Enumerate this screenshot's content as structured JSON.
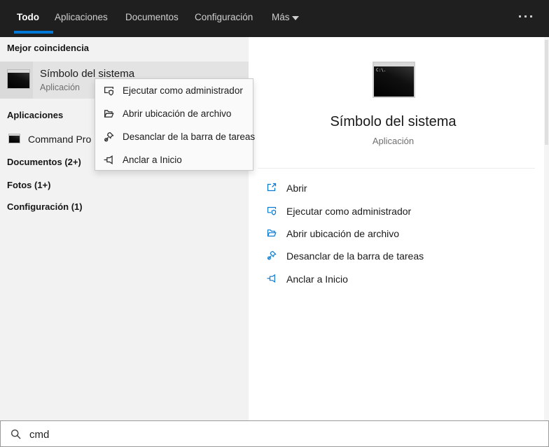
{
  "colors": {
    "accent": "#0078d7",
    "topbar_bg": "#1f1f1f",
    "panel_bg": "#f2f2f2",
    "action_icon": "#0b7ad1"
  },
  "topbar": {
    "tabs": [
      "Todo",
      "Aplicaciones",
      "Documentos",
      "Configuración",
      "Más"
    ],
    "active_tab": "Todo"
  },
  "left_panel": {
    "best_match_header": "Mejor coincidencia",
    "best_match_title": "Símbolo del sistema",
    "best_match_subtitle": "Aplicación",
    "apps_header": "Aplicaciones",
    "app_item_label": "Command Pro",
    "documents_header": "Documentos (2+)",
    "photos_header": "Fotos (1+)",
    "settings_header": "Configuración (1)"
  },
  "context_menu": {
    "items": [
      {
        "icon": "run-as-admin-icon",
        "label": "Ejecutar como administrador"
      },
      {
        "icon": "file-location-icon",
        "label": "Abrir ubicación de archivo"
      },
      {
        "icon": "unpin-taskbar-icon",
        "label": "Desanclar de la barra de tareas"
      },
      {
        "icon": "pin-to-start-icon",
        "label": "Anclar a Inicio"
      }
    ]
  },
  "right_panel": {
    "title": "Símbolo del sistema",
    "subtitle": "Aplicación",
    "terminal_icon_text": "C:\\.",
    "actions": [
      {
        "icon": "open-icon",
        "label": "Abrir"
      },
      {
        "icon": "run-as-admin-icon",
        "label": "Ejecutar como administrador"
      },
      {
        "icon": "file-location-icon",
        "label": "Abrir ubicación de archivo"
      },
      {
        "icon": "unpin-taskbar-icon",
        "label": "Desanclar de la barra de tareas"
      },
      {
        "icon": "pin-to-start-icon",
        "label": "Anclar a Inicio"
      }
    ]
  },
  "search": {
    "value": "cmd"
  }
}
